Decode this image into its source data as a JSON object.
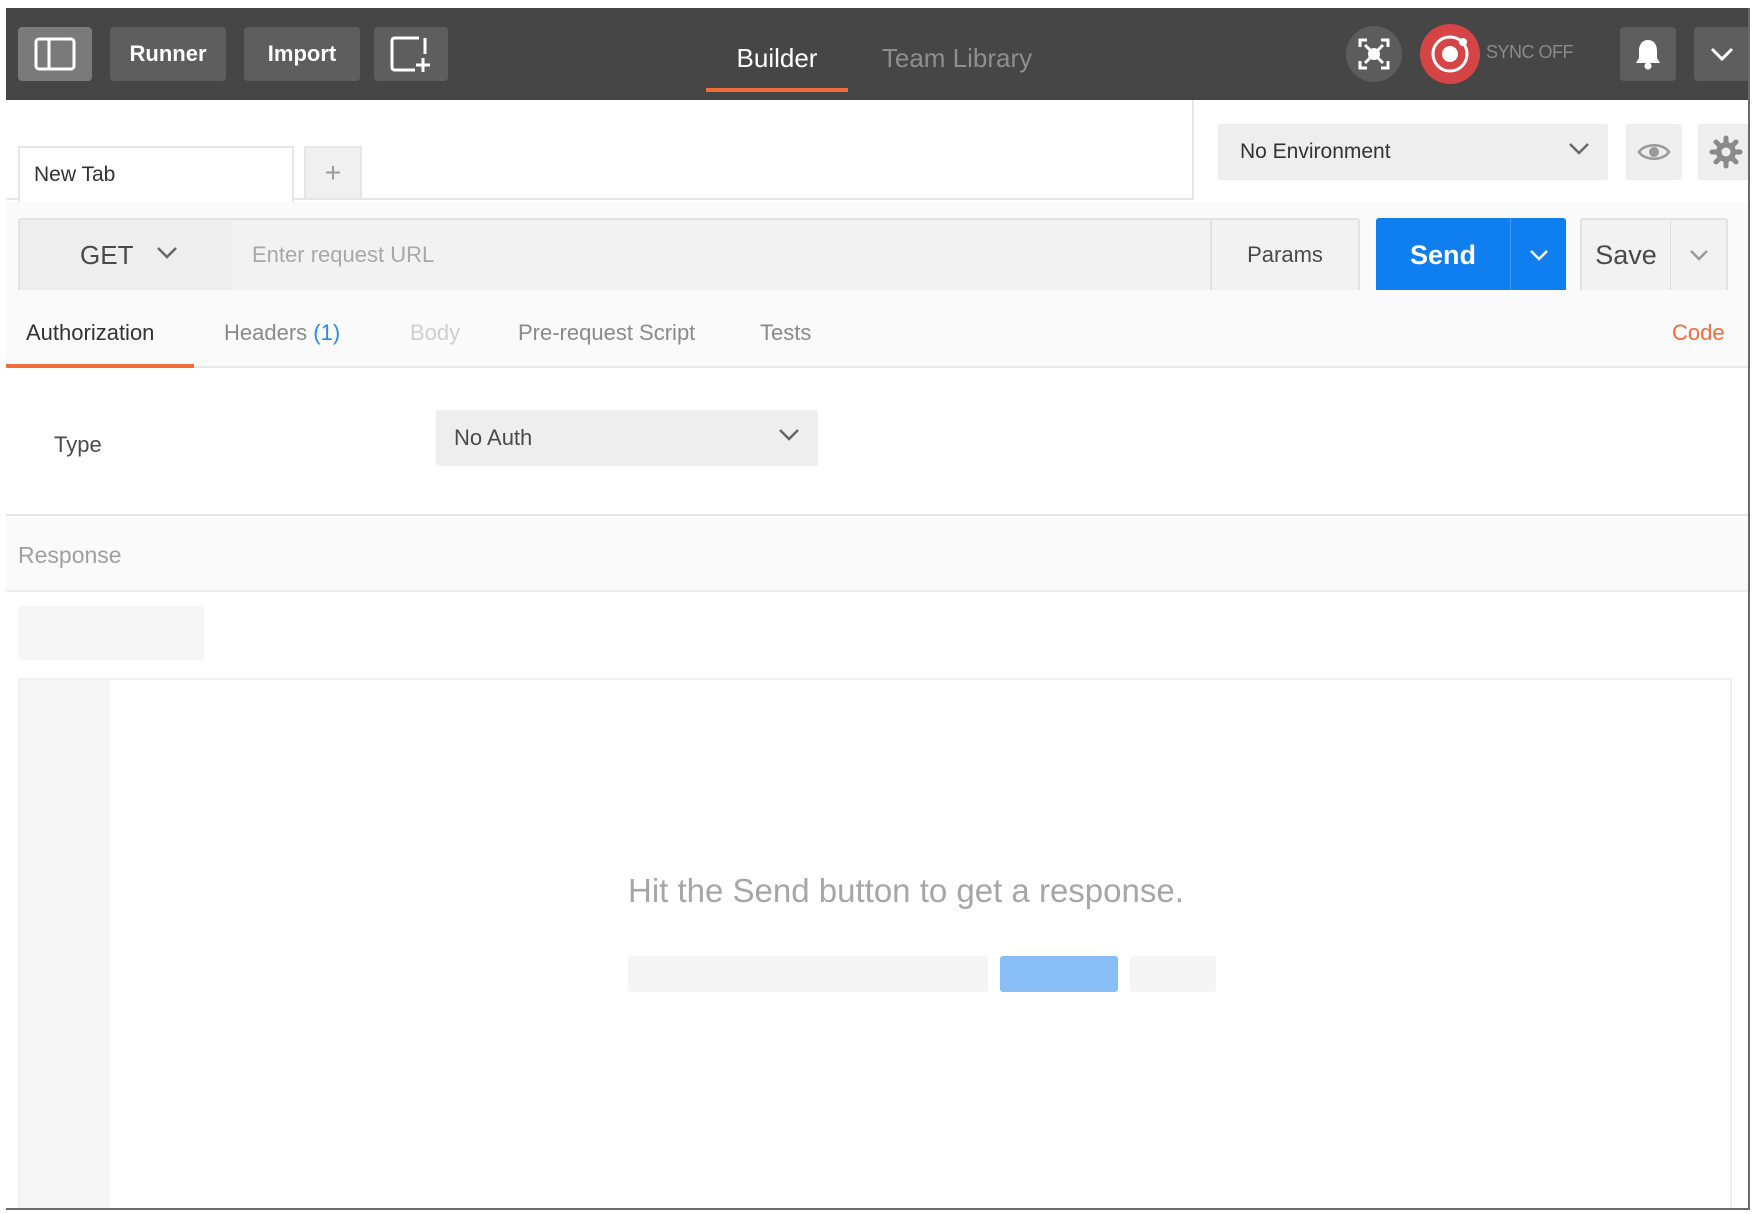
{
  "topbar": {
    "runner_label": "Runner",
    "import_label": "Import",
    "nav": {
      "builder": "Builder",
      "team_library": "Team Library"
    },
    "sync_status": "SYNC OFF",
    "icons": {
      "sidebar_toggle": "sidebar-toggle-icon",
      "new_window": "new-window-icon",
      "interceptor": "interceptor-icon",
      "sync": "sync-icon",
      "bell": "bell-icon",
      "menu": "chevron-down-icon"
    }
  },
  "tabs": {
    "items": [
      {
        "label": "New Tab"
      }
    ],
    "add_label": "+"
  },
  "environment": {
    "selected": "No Environment"
  },
  "request": {
    "method": "GET",
    "url_value": "",
    "url_placeholder": "Enter request URL",
    "params_label": "Params",
    "send_label": "Send",
    "save_label": "Save"
  },
  "subtabs": {
    "authorization": "Authorization",
    "headers": "Headers",
    "headers_count": "(1)",
    "body": "Body",
    "prerequest": "Pre-request Script",
    "tests": "Tests",
    "code": "Code"
  },
  "auth": {
    "type_label": "Type",
    "type_value": "No Auth"
  },
  "response": {
    "title": "Response",
    "empty_message": "Hit the Send button to get a response."
  },
  "colors": {
    "topbar_bg": "#464646",
    "accent_orange": "#f26b3a",
    "send_blue": "#0f7ff0",
    "headers_count_blue": "#2b8ae6",
    "sync_red": "#d64545"
  }
}
